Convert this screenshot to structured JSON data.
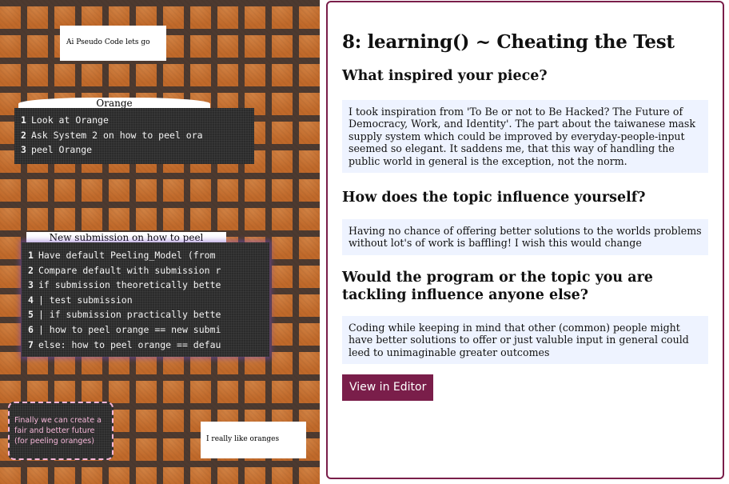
{
  "canvas": {
    "note_top": "Ai Pseudo Code lets go",
    "tab_orange": "Orange",
    "code_orange": [
      {
        "num": "1",
        "text": "Look at Orange"
      },
      {
        "num": "2",
        "text": "Ask System 2 on how to peel ora"
      },
      {
        "num": "3",
        "text": "peel Orange"
      }
    ],
    "tab_new": "New submission on how to peel",
    "code_new": [
      {
        "num": "1",
        "text": "Have default Peeling_Model (from"
      },
      {
        "num": "2",
        "text": "Compare default with submission r"
      },
      {
        "num": "3",
        "text": "if submission theoretically bette"
      },
      {
        "num": "4",
        "text": "|  test submission"
      },
      {
        "num": "5",
        "text": "|   if submission practically bette"
      },
      {
        "num": "6",
        "text": "|  how to peel orange == new submi"
      },
      {
        "num": "7",
        "text": "else: how to peel orange == defau"
      }
    ],
    "slogan": "Finally we can create a fair and better future (for peeling oranges)",
    "note_bottom": "I really like oranges"
  },
  "panel": {
    "title": "8: learning() ~ Cheating the Test",
    "q1": "What inspired your piece?",
    "a1": "I took inspiration from 'To Be or not to Be Hacked? The Future of Democracy, Work, and Identity'. The part about the taiwanese mask supply system which could be improved by everyday-people-input seemed so elegant. It saddens me, that this way of handling the public world in general is the exception, not the norm.",
    "q2": "How does the topic influence yourself?",
    "a2": "Having no chance of offering better solutions to the worlds problems without lot's of work is baffling! I wish this would change",
    "q3": "Would the program or the topic you are tackling influence anyone else?",
    "a3": "Coding while keeping in mind that other (common) people might have better solutions to offer or just valuble input in general could leed to unimaginable greater outcomes",
    "button_label": "View in Editor"
  },
  "colors": {
    "accent": "#7a1e4a",
    "answer_bg": "#eef3ff",
    "brick": "#c0692a",
    "slogan_pink": "#f6b7d9"
  }
}
